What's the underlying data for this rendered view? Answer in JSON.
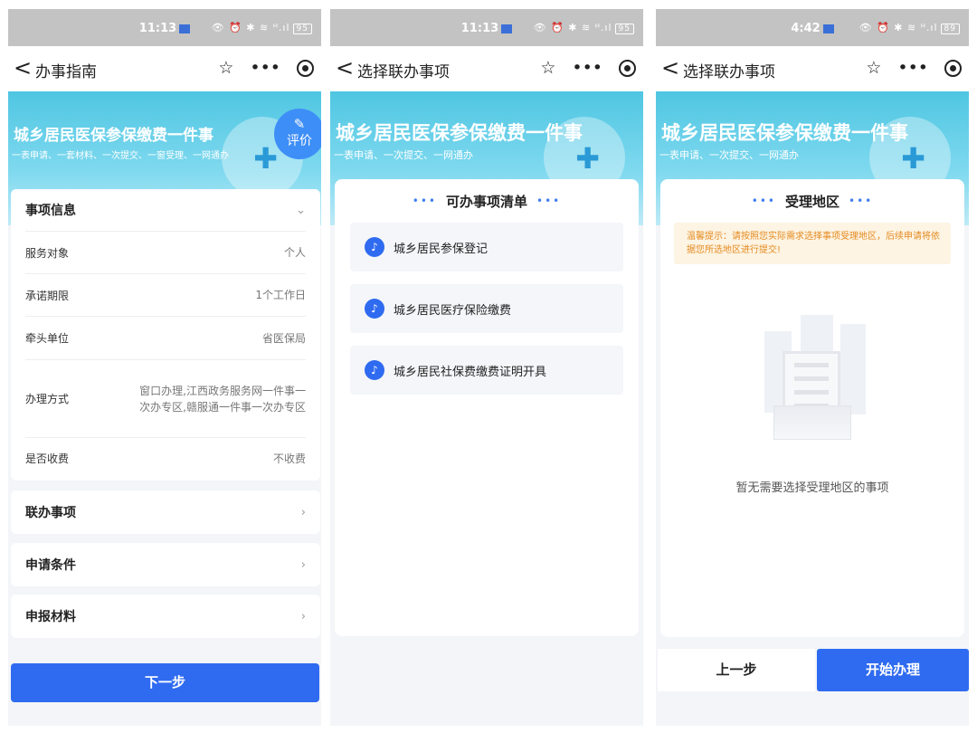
{
  "screen1": {
    "status": {
      "time": "11:13",
      "icons": "👁 ⏰ ✱ ≋ ᴴ.ıl",
      "battery": "95"
    },
    "nav": {
      "back": "<",
      "title": "办事指南",
      "star": "☆",
      "more": "•••"
    },
    "banner": {
      "title": "城乡居民医保参保缴费一件事",
      "subtitle": "一表申请、一套材料、一次提交、一窗受理、一网通办"
    },
    "fab": {
      "pen": "✎",
      "label": "评价"
    },
    "info_card": {
      "header": "事项信息",
      "chevron": "⌄",
      "rows": [
        {
          "key": "服务对象",
          "value": "个人"
        },
        {
          "key": "承诺期限",
          "value": "1个工作日"
        },
        {
          "key": "牵头单位",
          "value": "省医保局"
        },
        {
          "key": "办理方式",
          "value": "窗口办理,江西政务服务网一件事一次办专区,赣服通一件事一次办专区"
        },
        {
          "key": "是否收费",
          "value": "不收费"
        }
      ]
    },
    "sections": [
      {
        "label": "联办事项",
        "chevron": "›"
      },
      {
        "label": "申请条件",
        "chevron": "›"
      },
      {
        "label": "申报材料",
        "chevron": "›"
      }
    ],
    "next_button": "下一步"
  },
  "screen2": {
    "status": {
      "time": "11:13",
      "icons": "👁 ⏰ ✱ ≋ ᴴ.ıl",
      "battery": "95"
    },
    "nav": {
      "back": "<",
      "title": "选择联办事项",
      "star": "☆",
      "more": "•••"
    },
    "banner": {
      "title": "城乡居民医保参保缴费一件事",
      "subtitle": "一表申请、一次提交、一网通办"
    },
    "panel": {
      "dots_left": "•••",
      "title": "可办事项清单",
      "dots_right": "•••",
      "items": [
        {
          "label": "城乡居民参保登记"
        },
        {
          "label": "城乡居民医疗保险缴费"
        },
        {
          "label": "城乡居民社保费缴费证明开具"
        }
      ]
    }
  },
  "screen3": {
    "status": {
      "time": "4:42",
      "icons": "👁 ⏰ ✱ ≋ ᴴ.ıl",
      "battery": "89"
    },
    "nav": {
      "back": "<",
      "title": "选择联办事项",
      "star": "☆",
      "more": "•••"
    },
    "banner": {
      "title": "城乡居民医保参保缴费一件事",
      "subtitle": "一表申请、一次提交、一网通办"
    },
    "panel": {
      "dots_left": "•••",
      "title": "受理地区",
      "dots_right": "•••",
      "notice": "温馨提示：请按照您实际需求选择事项受理地区，后续申请将依据您所选地区进行提交!",
      "empty_text": "暂无需要选择受理地区的事项"
    },
    "prev_button": "上一步",
    "start_button": "开始办理"
  },
  "colors": {
    "primary": "#2f6bf0",
    "banner": "#4fc6e2",
    "notice_text": "#e58a1f",
    "notice_bg": "#fdf4e3"
  }
}
